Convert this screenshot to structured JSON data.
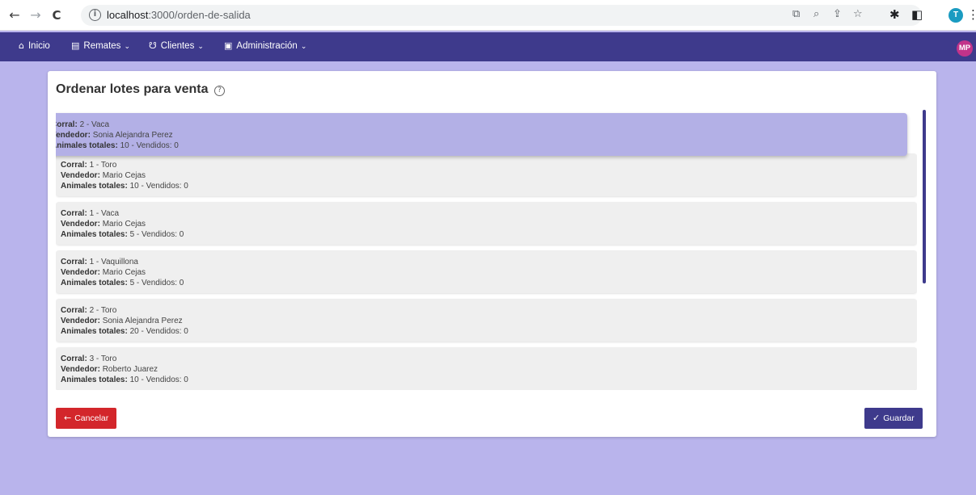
{
  "browser": {
    "back_icon": "←",
    "forward_icon": "→",
    "reload_icon": "C",
    "url_host": "localhost",
    "url_path": ":3000/orden-de-salida",
    "profile_initial": "T"
  },
  "navbar": {
    "items": [
      {
        "icon": "⌂",
        "label": "Inicio"
      },
      {
        "icon": "▤",
        "label": "Remates",
        "chevron": "⌄"
      },
      {
        "icon": "☋",
        "label": "Clientes",
        "chevron": "⌄"
      },
      {
        "icon": "▣",
        "label": "Administración",
        "chevron": "⌄"
      }
    ],
    "avatar_initials": "MP",
    "color": "#3e3a8c"
  },
  "page": {
    "title": "Ordenar lotes para venta",
    "help_icon": "?"
  },
  "labels": {
    "corral": "Corral:",
    "vendedor": "Vendedor:",
    "animales": "Animales totales:"
  },
  "lots": [
    {
      "corral": "2 - Vaca",
      "vendedor": "Sonia Alejandra Perez",
      "animales": "10 - Vendidos: 0",
      "dragging": true
    },
    {
      "corral": "1 - Toro",
      "vendedor": "Mario Cejas",
      "animales": "10 - Vendidos: 0"
    },
    {
      "corral": "1 - Vaca",
      "vendedor": "Mario Cejas",
      "animales": "5 - Vendidos: 0"
    },
    {
      "corral": "1 - Vaquillona",
      "vendedor": "Mario Cejas",
      "animales": "5 - Vendidos: 0"
    },
    {
      "corral": "2 - Toro",
      "vendedor": "Sonia Alejandra Perez",
      "animales": "20 - Vendidos: 0"
    },
    {
      "corral": "3 - Toro",
      "vendedor": "Roberto Juarez",
      "animales": "10 - Vendidos: 0"
    }
  ],
  "buttons": {
    "cancel_label": "Cancelar",
    "cancel_icon": "←",
    "cancel_color": "#d3262b",
    "save_label": "Guardar",
    "save_icon": "✓",
    "save_color": "#3e3a8c"
  },
  "background_color": "#b9b4ec"
}
